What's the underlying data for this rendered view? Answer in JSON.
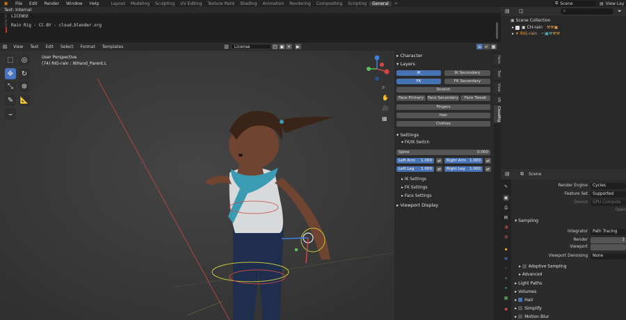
{
  "menu": {
    "items": [
      "File",
      "Edit",
      "Render",
      "Window",
      "Help"
    ],
    "workspaces": [
      "Layout",
      "Modeling",
      "Sculpting",
      "UV Editing",
      "Texture Paint",
      "Shading",
      "Animation",
      "Rendering",
      "Compositing",
      "Scripting",
      "General"
    ],
    "active_workspace": "General",
    "add_tab": "+",
    "scene_label": "Scene",
    "view_layer_label": "View Lay"
  },
  "text_editor": {
    "title": "Text: Internal",
    "lines": [
      {
        "num": "1",
        "text": "LICENSE"
      },
      {
        "num": "2",
        "text": ""
      },
      {
        "num": "3",
        "text": "Rain Rig - CC-BY - cloud.blender.org"
      }
    ],
    "menu": [
      "View",
      "Text",
      "Edit",
      "Select",
      "Format",
      "Templates"
    ],
    "file_name": "License"
  },
  "viewport": {
    "perspective": "User Perspective",
    "object_info": "(74) RIG-rain : IKHand_Parent.L",
    "colors": {
      "background": "#3a3a3a",
      "select_tool": "#4c75c0"
    }
  },
  "npanel": {
    "character_label": "Character",
    "layers_label": "Layers",
    "buttons": {
      "ik": "IK",
      "ik_secondary": "IK Secondary",
      "fk": "FK",
      "fk_secondary": "FK Secondary",
      "stretch": "Stretch",
      "face_primary": "Face Primary",
      "face_secondary": "Face Secondary",
      "face_tweak": "Face Tweak",
      "fingers": "Fingers",
      "hair": "Hair",
      "clothes": "Clothes"
    },
    "settings_label": "Settings",
    "fkik_label": "FK/IK Switch",
    "spine": {
      "label": "Spine",
      "value": "0.000"
    },
    "left_arm": {
      "label": "Left Arm",
      "value": "1.000"
    },
    "right_arm": {
      "label": "Right Arm",
      "value": "1.000"
    },
    "left_leg": {
      "label": "Left Leg",
      "value": "1.000"
    },
    "right_leg": {
      "label": "Right Leg",
      "value": "1.000"
    },
    "ik_settings": "IK Settings",
    "fk_settings": "FK Settings",
    "face_settings": "Face Settings",
    "viewport_display": "Viewport Display",
    "tabs": [
      "Item",
      "Tool",
      "View",
      "VR",
      "CloudRig"
    ]
  },
  "outliner": {
    "root": "Scene Collection",
    "items": [
      "CH-rain",
      "RIG-rain"
    ]
  },
  "properties": {
    "scene": "Scene",
    "render_engine_label": "Render Engine",
    "render_engine": "Cycles",
    "feature_set_label": "Feature Set",
    "feature_set": "Supported",
    "device_label": "Device",
    "device": "GPU Compute",
    "open_label": "Open",
    "sampling": "Sampling",
    "integrator_label": "Integrator",
    "integrator": "Path Tracing",
    "render_label": "Render",
    "render_value": "1",
    "viewport_label": "Viewport",
    "denoising_label": "Viewport Denoising",
    "denoising": "None",
    "adaptive": "Adaptive Sampling",
    "advanced": "Advanced",
    "light_paths": "Light Paths",
    "volumes": "Volumes",
    "hair": "Hair",
    "simplify": "Simplify",
    "motion_blur": "Motion Blur"
  }
}
